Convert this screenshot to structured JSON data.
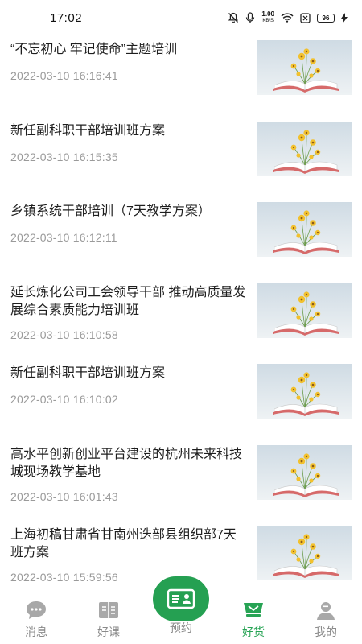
{
  "status_bar": {
    "time": "17:02",
    "net_speed_value": "1.00",
    "net_speed_unit": "KB/S",
    "battery": "96"
  },
  "items": [
    {
      "title": "“不忘初心 牢记使命”主题培训",
      "time": "2022-03-10 16:16:41"
    },
    {
      "title": "新任副科职干部培训班方案",
      "time": "2022-03-10 16:15:35"
    },
    {
      "title": "乡镇系统干部培训（7天教学方案）",
      "time": "2022-03-10 16:12:11"
    },
    {
      "title": "延长炼化公司工会领导干部  推动高质量发展综合素质能力培训班",
      "time": "2022-03-10 16:10:58"
    },
    {
      "title": "新任副科职干部培训班方案",
      "time": "2022-03-10 16:10:02"
    },
    {
      "title": "高水平创新创业平台建设的杭州未来科技城现场教学基地",
      "time": "2022-03-10 16:01:43"
    },
    {
      "title": "上海初稿甘肃省甘南州迭部县组织部7天班方案",
      "time": "2022-03-10 15:59:56"
    }
  ],
  "tabs": {
    "messages": "消息",
    "courses": "好课",
    "booking": "预约",
    "goods": "好货",
    "mine": "我的"
  },
  "colors": {
    "accent": "#27a354",
    "tab_inactive": "#8a8a8a",
    "timestamp": "#9a9a9a"
  },
  "icons": {
    "thumbnail": "book-flowers-image",
    "messages": "chat-bubble-icon",
    "courses": "book-icon",
    "booking": "id-card-icon",
    "goods": "shopping-basket-icon",
    "mine": "person-icon"
  }
}
